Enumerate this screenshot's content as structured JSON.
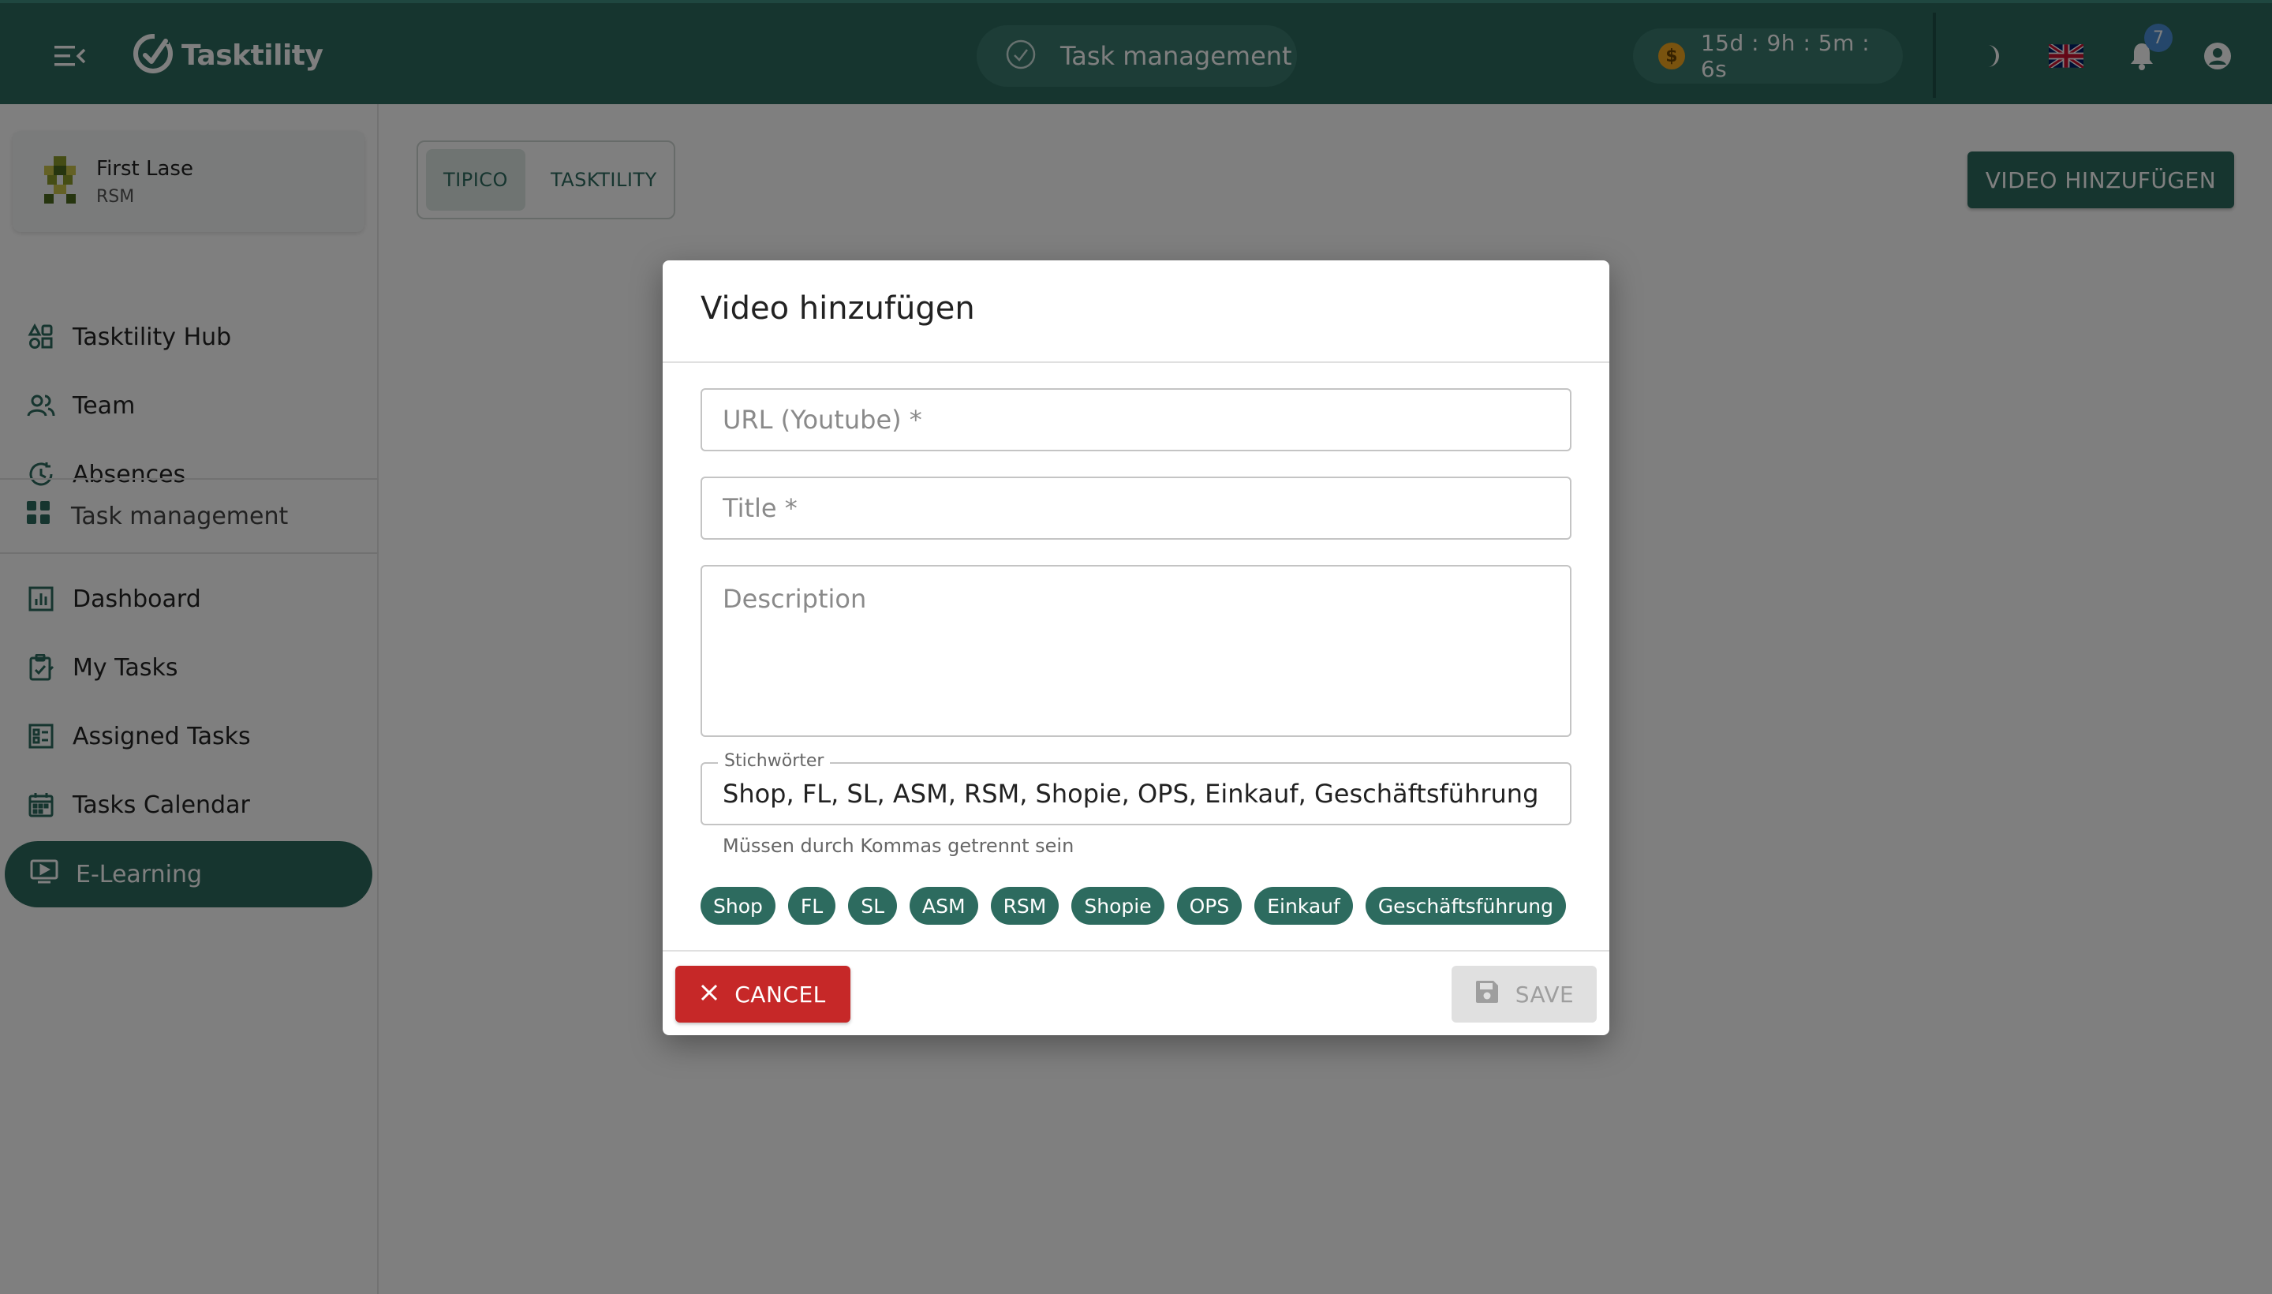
{
  "header": {
    "brand": "Tasktility",
    "module": "Task management",
    "timer": "15d : 9h : 5m : 6s",
    "notification_count": "7",
    "coin_symbol": "$"
  },
  "sidebar": {
    "profile": {
      "name": "First Lase",
      "role": "RSM"
    },
    "items": [
      {
        "label": "Tasktility Hub",
        "icon": "hub-icon"
      },
      {
        "label": "Team",
        "icon": "team-icon"
      },
      {
        "label": "Absences",
        "icon": "absences-icon"
      }
    ],
    "section": {
      "label": "Task management",
      "icon": "grid-icon"
    },
    "task_items": [
      {
        "label": "Dashboard",
        "icon": "dashboard-icon"
      },
      {
        "label": "My Tasks",
        "icon": "clipboard-icon"
      },
      {
        "label": "Assigned Tasks",
        "icon": "assigned-icon"
      },
      {
        "label": "Tasks Calendar",
        "icon": "calendar-icon"
      },
      {
        "label": "E-Learning",
        "icon": "video-icon",
        "active": true
      }
    ]
  },
  "main": {
    "tabs": [
      {
        "label": "TIPICO",
        "active": true
      },
      {
        "label": "TASKTILITY",
        "active": false
      }
    ],
    "add_video_label": "VIDEO HINZUFÜGEN"
  },
  "dialog": {
    "title": "Video hinzufügen",
    "url_placeholder": "URL (Youtube) *",
    "title_placeholder": "Title *",
    "description_placeholder": "Description",
    "keywords_label": "Stichwörter",
    "keywords_value": "Shop, FL, SL, ASM, RSM, Shopie, OPS, Einkauf, Geschäftsführung",
    "helper_text": "Müssen durch Kommas getrennt sein",
    "chips": [
      "Shop",
      "FL",
      "SL",
      "ASM",
      "RSM",
      "Shopie",
      "OPS",
      "Einkauf",
      "Geschäftsführung"
    ],
    "cancel_label": "CANCEL",
    "save_label": "SAVE"
  },
  "colors": {
    "primary": "#2d6b5f",
    "danger": "#c62828",
    "coin": "#f2a61f"
  }
}
